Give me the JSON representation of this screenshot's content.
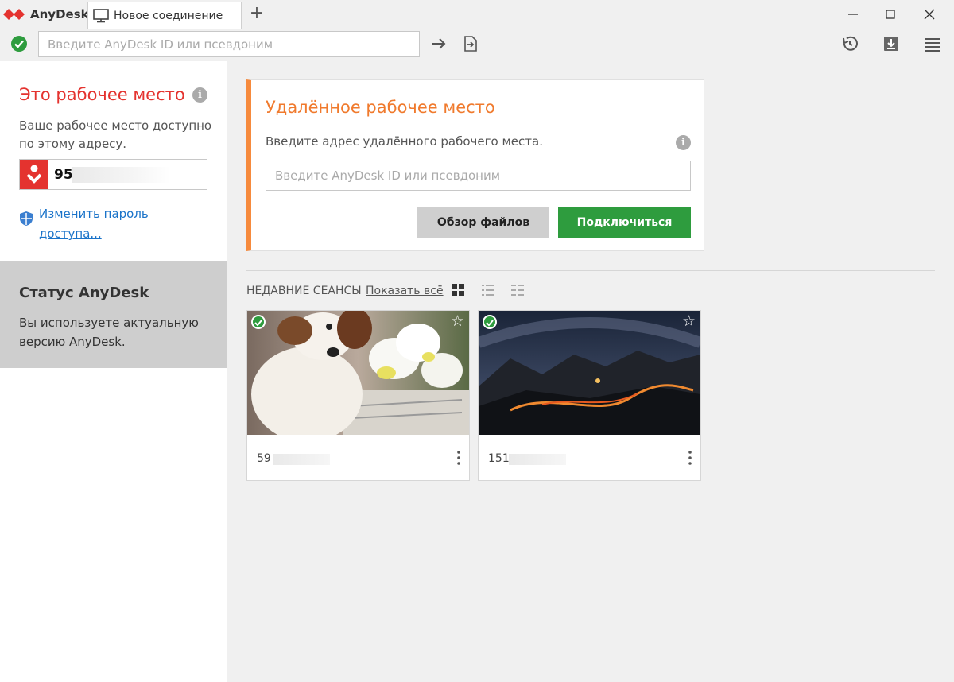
{
  "app": {
    "name": "AnyDesk"
  },
  "tab": {
    "label": "Новое соединение"
  },
  "toolbar": {
    "address_placeholder": "Введите AnyDesk ID или псевдоним"
  },
  "workspace": {
    "title": "Это рабочее место",
    "description": "Ваше рабочее место доступно по этому адресу.",
    "id_visible": "95",
    "change_password": "Изменить пароль доступа..."
  },
  "status": {
    "title": "Статус AnyDesk",
    "text": "Вы используете актуальную версию AnyDesk."
  },
  "remote": {
    "title": "Удалённое рабочее место",
    "description": "Введите адрес удалённого рабочего места.",
    "placeholder": "Введите AnyDesk ID или псевдоним",
    "browse_files": "Обзор файлов",
    "connect": "Подключиться"
  },
  "recent": {
    "label": "НЕДАВНИЕ СЕАНСЫ",
    "show_all": "Показать всё",
    "sessions": [
      {
        "id_visible": "59",
        "thumbnail": "dog-photo",
        "favorite": false
      },
      {
        "id_visible": "151",
        "thumbnail": "night-mountain-road",
        "favorite": false
      }
    ]
  },
  "colors": {
    "brand_red": "#e4332f",
    "remote_orange": "#f07a2d",
    "connect_green": "#2e9c3e",
    "link_blue": "#1a73c9"
  }
}
